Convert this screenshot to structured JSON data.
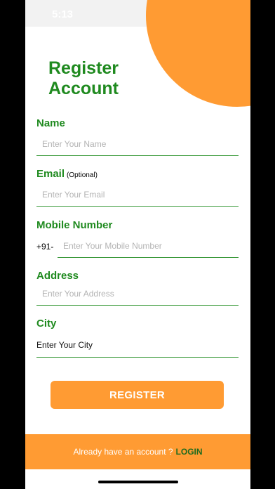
{
  "status_bar": {
    "time": "5:13"
  },
  "page": {
    "title_line1": "Register",
    "title_line2": "Account"
  },
  "form": {
    "name": {
      "label": "Name",
      "placeholder": "Enter Your Name",
      "value": ""
    },
    "email": {
      "label": "Email",
      "optional_note": "(Optional)",
      "placeholder": "Enter Your Email",
      "value": ""
    },
    "mobile": {
      "label": "Mobile Number",
      "prefix": "+91-",
      "placeholder": "Enter Your Mobile Number",
      "value": ""
    },
    "address": {
      "label": "Address",
      "placeholder": "Enter Your Address",
      "value": ""
    },
    "city": {
      "label": "City",
      "value": "Enter Your City"
    },
    "register_label": "REGISTER"
  },
  "footer": {
    "prompt": "Already have an account ?",
    "login_label": "LOGIN"
  },
  "colors": {
    "accent_orange": "#ff9b33",
    "label_green": "#1f8a1f",
    "underline_green": "#3b9a3b",
    "login_green": "#1f6b1f"
  },
  "icons": {
    "signal": "cellular-signal-icon",
    "wifi": "wifi-icon",
    "battery": "battery-icon"
  }
}
